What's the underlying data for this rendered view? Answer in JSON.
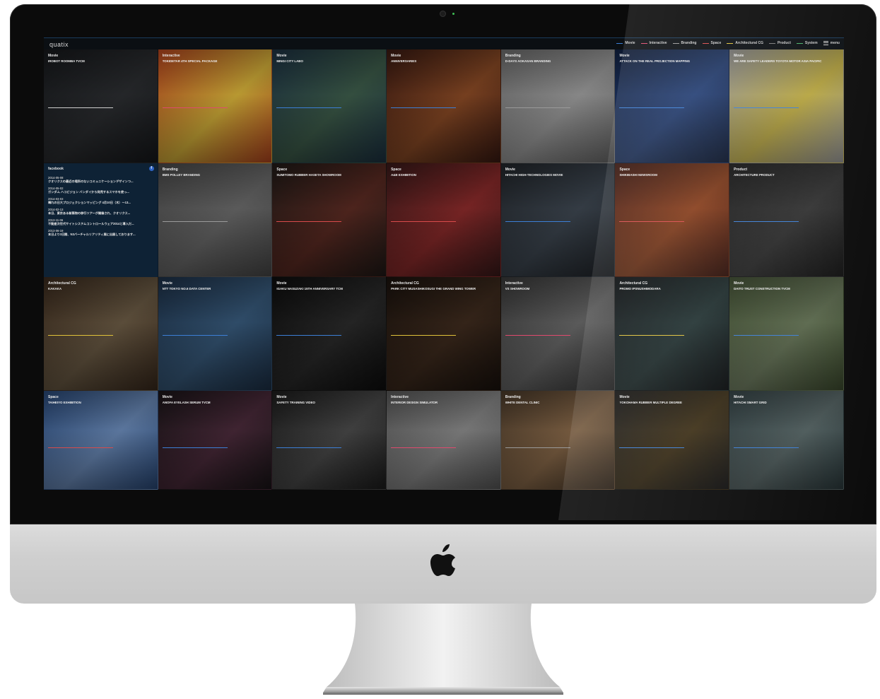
{
  "site": {
    "brand": "quatix",
    "nav": [
      {
        "label": "Movie",
        "color": "#3c7fd6"
      },
      {
        "label": "Interactive",
        "color": "#e04a6e"
      },
      {
        "label": "Branding",
        "color": "#9a9a9a"
      },
      {
        "label": "Space",
        "color": "#d94b4b"
      },
      {
        "label": "Architectural CG",
        "color": "#e0c23a"
      },
      {
        "label": "Product",
        "color": "#7b7b7b"
      },
      {
        "label": "System",
        "color": "#4ab36a"
      }
    ],
    "menu_label": "menu"
  },
  "facebook": {
    "heading": "facebook",
    "icon": "f",
    "entries": [
      {
        "date": "2014-05-08",
        "text": "クオリクスの最近の場所のないコミュニケーションデザインつ..."
      },
      {
        "date": "2014-05-02",
        "text": "ガンダム ハコビジョン バンダイから発売するスマホを使っ..."
      },
      {
        "date": "2014-03-03",
        "text": "晴れの日大プロジェクションマッピング 4月10日（木）〜13..."
      },
      {
        "date": "2014-02-13",
        "text": "本日、東京ある新築物の移行ツアーが開催され、クオリクス..."
      },
      {
        "date": "2013-11-06",
        "text": "不動産次世代サイトシステムコントロールウェア2014と導入だ..."
      },
      {
        "date": "2013-06-19",
        "text": "本日より3日間、N3バーチャルリアリティ展に出展しております..."
      }
    ]
  },
  "tiles": [
    {
      "category": "Movie",
      "title": "iRobot Roomba TVCM",
      "bg": "#17191c",
      "bg2": "#2b2d30",
      "line": "#cfcfcf"
    },
    {
      "category": "Interactive",
      "title": "TOKIDETAR 4th Special Package",
      "bg": "#b9461f",
      "bg2": "#d8b33a",
      "line": "#e04a6e"
    },
    {
      "category": "Movie",
      "title": "MINGI CITY LABO",
      "bg": "#1d3344",
      "bg2": "#3d5c4a",
      "line": "#3c7fd6"
    },
    {
      "category": "Movie",
      "title": "ANNIVERSARIES",
      "bg": "#3b1a12",
      "bg2": "#8a4a25",
      "line": "#3c7fd6"
    },
    {
      "category": "Branding",
      "title": "D-DAYS AOKASAN BRANDING",
      "bg": "#6f6f6f",
      "bg2": "#9e9e9e",
      "line": "#9a9a9a"
    },
    {
      "category": "Movie",
      "title": "ATTACK ON THE REAL PROJECTION MAPPING",
      "bg": "#132447",
      "bg2": "#2d4c8a",
      "line": "#3c7fd6"
    },
    {
      "category": "Movie",
      "title": "WE ARE SAFETY LEADERS TOYOTA MOTOR ASIA PACIFIC",
      "bg": "#a6a6a6",
      "bg2": "#d7c24c",
      "line": "#3c7fd6"
    },
    {
      "category": "Branding",
      "title": "BMS POLLEY BRANDING",
      "bg": "#4a4a4a",
      "bg2": "#6a6a6a",
      "line": "#9a9a9a"
    },
    {
      "category": "Space",
      "title": "SUMITOMO RUBBER HASETA SHOWROOM",
      "bg": "#201a17",
      "bg2": "#5a2a22",
      "line": "#d94b4b"
    },
    {
      "category": "Space",
      "title": "a&B Exhibition",
      "bg": "#3a1a1a",
      "bg2": "#8a2a2a",
      "line": "#d94b4b"
    },
    {
      "category": "Movie",
      "title": "HITACHI HIGH-TECHNOLOGIES MOVIE",
      "bg": "#22262b",
      "bg2": "#3d4650",
      "line": "#3c7fd6"
    },
    {
      "category": "Space",
      "title": "SHIKIBASHI NEWSROOM",
      "bg": "#4a1a10",
      "bg2": "#a04a22",
      "line": "#d94b4b"
    },
    {
      "category": "Product",
      "title": "ARCHITECTURE PRODUCT",
      "bg": "#1d1d1d",
      "bg2": "#3d3d3d",
      "line": "#3c7fd6"
    },
    {
      "category": "Architectural CG",
      "title": "KAKAKA",
      "bg": "#3a2a1d",
      "bg2": "#6a5a44",
      "line": "#e0c23a"
    },
    {
      "category": "Movie",
      "title": "NTT TOKYO No.6 DATA CENTER",
      "bg": "#1d3148",
      "bg2": "#37597a",
      "line": "#3c7fd6"
    },
    {
      "category": "Movie",
      "title": "Igaku Nasuzaki 15th Anniversary TCM",
      "bg": "#0d0d0d",
      "bg2": "#2a2a2a",
      "line": "#3c7fd6"
    },
    {
      "category": "Architectural CG",
      "title": "PARK CITY MUSASHIKOSUGI THE GRAND WING TOWER",
      "bg": "#1a120d",
      "bg2": "#3d2a1d",
      "line": "#e0c23a"
    },
    {
      "category": "Interactive",
      "title": "VS SHOWROOM",
      "bg": "#3a3a3a",
      "bg2": "#6a6a6a",
      "line": "#e04a6e"
    },
    {
      "category": "Architectural CG",
      "title": "PROMO IPSNUSHIMODARA",
      "bg": "#0d1114",
      "bg2": "#2a3d3d",
      "line": "#e0c23a"
    },
    {
      "category": "Movie",
      "title": "DAITO TRUST CONSTRUCTION TVCM",
      "bg": "#3a4a2a",
      "bg2": "#6a7a5a",
      "line": "#3c7fd6"
    },
    {
      "category": "Space",
      "title": "TAIHEIYO EXHIBITION",
      "bg": "#2a4a7a",
      "bg2": "#6a8ab8",
      "line": "#d94b4b"
    },
    {
      "category": "Movie",
      "title": "ANOFA EYELASH SERUM TVCM",
      "bg": "#1a1518",
      "bg2": "#4a2a3a",
      "line": "#3c7fd6"
    },
    {
      "category": "Movie",
      "title": "SAFETY TRAINING VIDEO",
      "bg": "#1d1d1d",
      "bg2": "#4a4a4a",
      "line": "#3c7fd6"
    },
    {
      "category": "Interactive",
      "title": "INTERIOR DESIGN SIMULATOR",
      "bg": "#5a5a5a",
      "bg2": "#8a8a8a",
      "line": "#e04a6e"
    },
    {
      "category": "Branding",
      "title": "WHITE DENTAL CLINIC",
      "bg": "#4a3a2a",
      "bg2": "#8a6a4a",
      "line": "#9a9a9a"
    },
    {
      "category": "Movie",
      "title": "YOKOHAMA RUBBER MULTIPLE DEGREE",
      "bg": "#1d1d1d",
      "bg2": "#4a3a1d",
      "line": "#3c7fd6"
    },
    {
      "category": "Movie",
      "title": "HITACHI SMART GRID",
      "bg": "#2a3a3d",
      "bg2": "#5a6a6a",
      "line": "#3c7fd6"
    }
  ]
}
